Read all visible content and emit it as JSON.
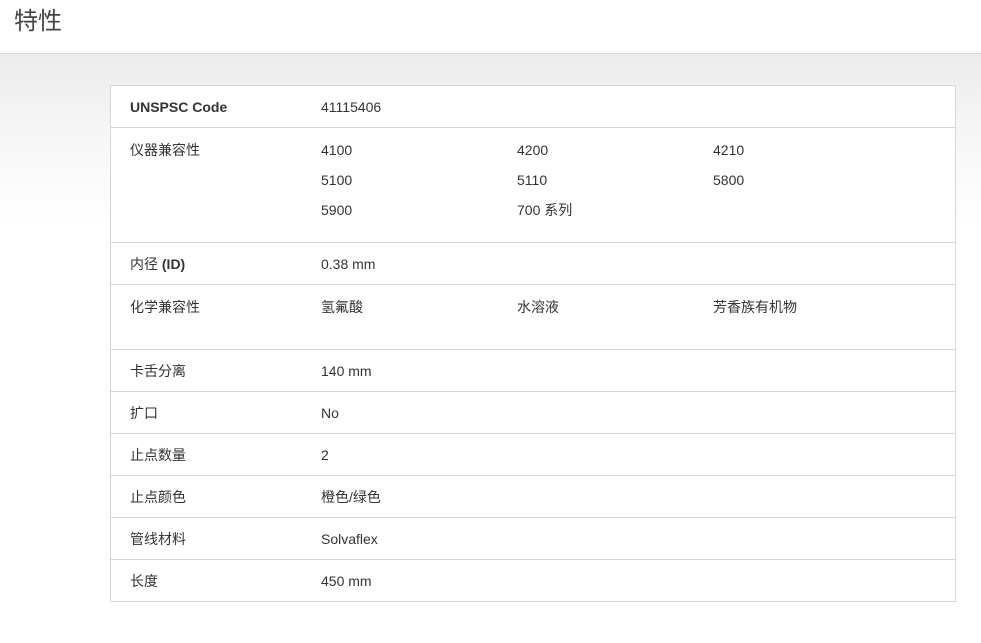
{
  "header": {
    "title": "特性"
  },
  "specs": {
    "unspsc": {
      "label": "UNSPSC Code",
      "value": "41115406"
    },
    "instrument": {
      "label": "仪器兼容性",
      "values": [
        "4100",
        "4200",
        "4210",
        "5100",
        "5110",
        "5800",
        "5900",
        "700 系列"
      ]
    },
    "inner_diameter": {
      "label_prefix": "内径 ",
      "label_bold": "(ID)",
      "value": "0.38 mm"
    },
    "chemical": {
      "label": "化学兼容性",
      "values": [
        "氢氟酸",
        "水溶液",
        "芳香族有机物"
      ]
    },
    "clamp_distance": {
      "label": "卡舌分离",
      "value": "140 mm"
    },
    "flared": {
      "label": "扩口",
      "value": "No"
    },
    "stop_count": {
      "label": "止点数量",
      "value": "2"
    },
    "stop_color": {
      "label": "止点颜色",
      "value": "橙色/绿色"
    },
    "tubing_material": {
      "label": "管线材料",
      "value": "Solvaflex"
    },
    "length": {
      "label": "长度",
      "value": "450 mm"
    }
  }
}
